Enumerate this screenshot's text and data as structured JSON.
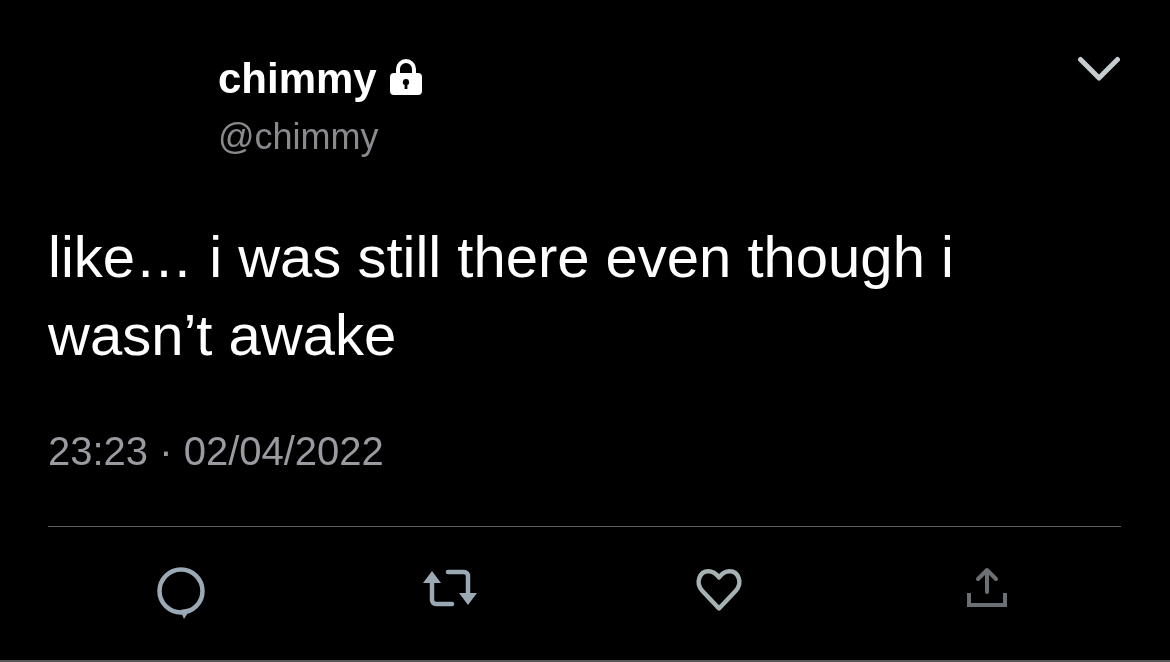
{
  "tweet": {
    "author": {
      "name": "chimmy",
      "protected": true,
      "handle": "@chimmy"
    },
    "text": "like… i was still there even though i wasn’t awake",
    "timestamp": "23:23 · 02/04/2022"
  }
}
